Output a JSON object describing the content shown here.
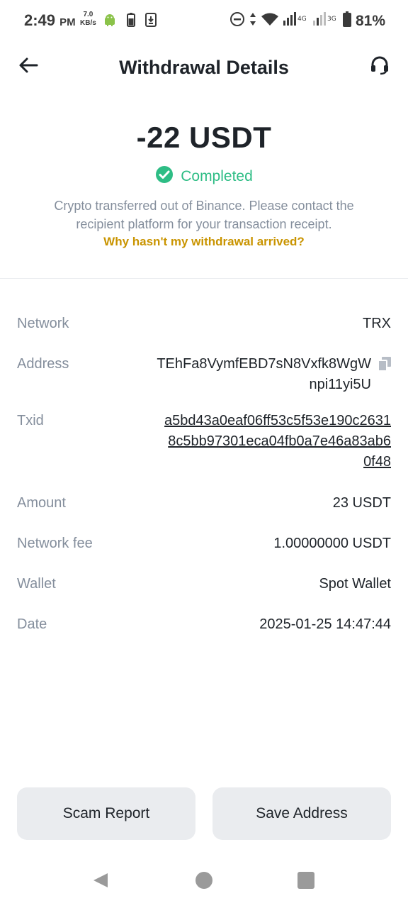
{
  "status_bar": {
    "time": "2:49",
    "ampm": "PM",
    "speed_value": "7.0",
    "speed_unit": "KB/s",
    "battery_percent": "81%",
    "icons": [
      "android-icon",
      "battery-small-icon",
      "download-icon",
      "dnd-icon",
      "data-arrows-icon",
      "wifi-icon",
      "signal-4g-icon",
      "signal-3g-icon",
      "battery-icon"
    ]
  },
  "header": {
    "title": "Withdrawal Details",
    "back_icon": "back-arrow-icon",
    "support_icon": "headset-icon"
  },
  "summary": {
    "amount": "-22 USDT",
    "status": "Completed",
    "description": "Crypto transferred out of Binance. Please contact the recipient platform for your transaction receipt.",
    "help_link": "Why hasn't my withdrawal arrived?"
  },
  "details": {
    "network": {
      "label": "Network",
      "value": "TRX"
    },
    "address": {
      "label": "Address",
      "value": "TEhFa8VymfEBD7sN8Vxfk8WgWnpi11yi5U"
    },
    "txid": {
      "label": "Txid",
      "value": "a5bd43a0eaf06ff53c5f53e190c26318c5bb97301eca04fb0a7e46a83ab60f48"
    },
    "amount": {
      "label": "Amount",
      "value": "23 USDT"
    },
    "network_fee": {
      "label": "Network fee",
      "value": "1.00000000 USDT"
    },
    "wallet": {
      "label": "Wallet",
      "value": "Spot Wallet"
    },
    "date": {
      "label": "Date",
      "value": "2025-01-25 14:47:44"
    }
  },
  "buttons": {
    "scam_report": "Scam Report",
    "save_address": "Save Address"
  },
  "colors": {
    "success": "#2ebd85",
    "link": "#c99400",
    "label": "#848e9c",
    "text": "#1e2329",
    "button_bg": "#eaecef"
  }
}
